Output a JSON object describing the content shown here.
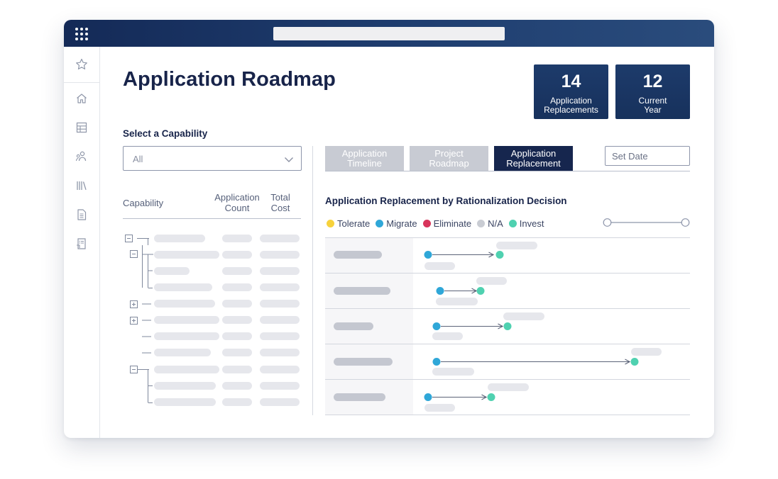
{
  "page_title": "Application Roadmap",
  "kpis": [
    {
      "value": "14",
      "label_line1": "Application",
      "label_line2": "Replacements"
    },
    {
      "value": "12",
      "label_line1": "Current",
      "label_line2": "Year"
    }
  ],
  "capability": {
    "title": "Select a Capability",
    "selected": "All",
    "columns": {
      "capability": "Capability",
      "app_count_line1": "Application",
      "app_count_line2": "Count",
      "total_cost_line1": "Total",
      "total_cost_line2": "Cost"
    }
  },
  "tabs": [
    {
      "line1": "Application",
      "line2": "Timeline",
      "active": false
    },
    {
      "line1": "Project",
      "line2": "Roadmap",
      "active": false
    },
    {
      "line1": "Application",
      "line2": "Replacement",
      "active": true
    }
  ],
  "set_date": {
    "placeholder": "Set Date"
  },
  "chart": {
    "title": "Application Replacement by Rationalization Decision",
    "legend": [
      {
        "name": "Tolerate",
        "color": "#f7d23c"
      },
      {
        "name": "Migrate",
        "color": "#2fa7d8"
      },
      {
        "name": "Eliminate",
        "color": "#d8345b"
      },
      {
        "name": "N/A",
        "color": "#c9ccd3"
      },
      {
        "name": "Invest",
        "color": "#4fd1b0"
      }
    ]
  },
  "colors": {
    "navy": "#16264e",
    "placeholder_bar": "#e6e7ec",
    "label_bar": "#c4c7d0",
    "migrate": "#2fa7d8",
    "invest": "#4fd1b0"
  },
  "icons": {
    "sidebar": [
      "star-icon",
      "home-icon",
      "table-icon",
      "users-icon",
      "library-icon",
      "document-icon",
      "report-icon"
    ],
    "topbar": "app-grid-icon",
    "select": "chevron-down-icon"
  }
}
